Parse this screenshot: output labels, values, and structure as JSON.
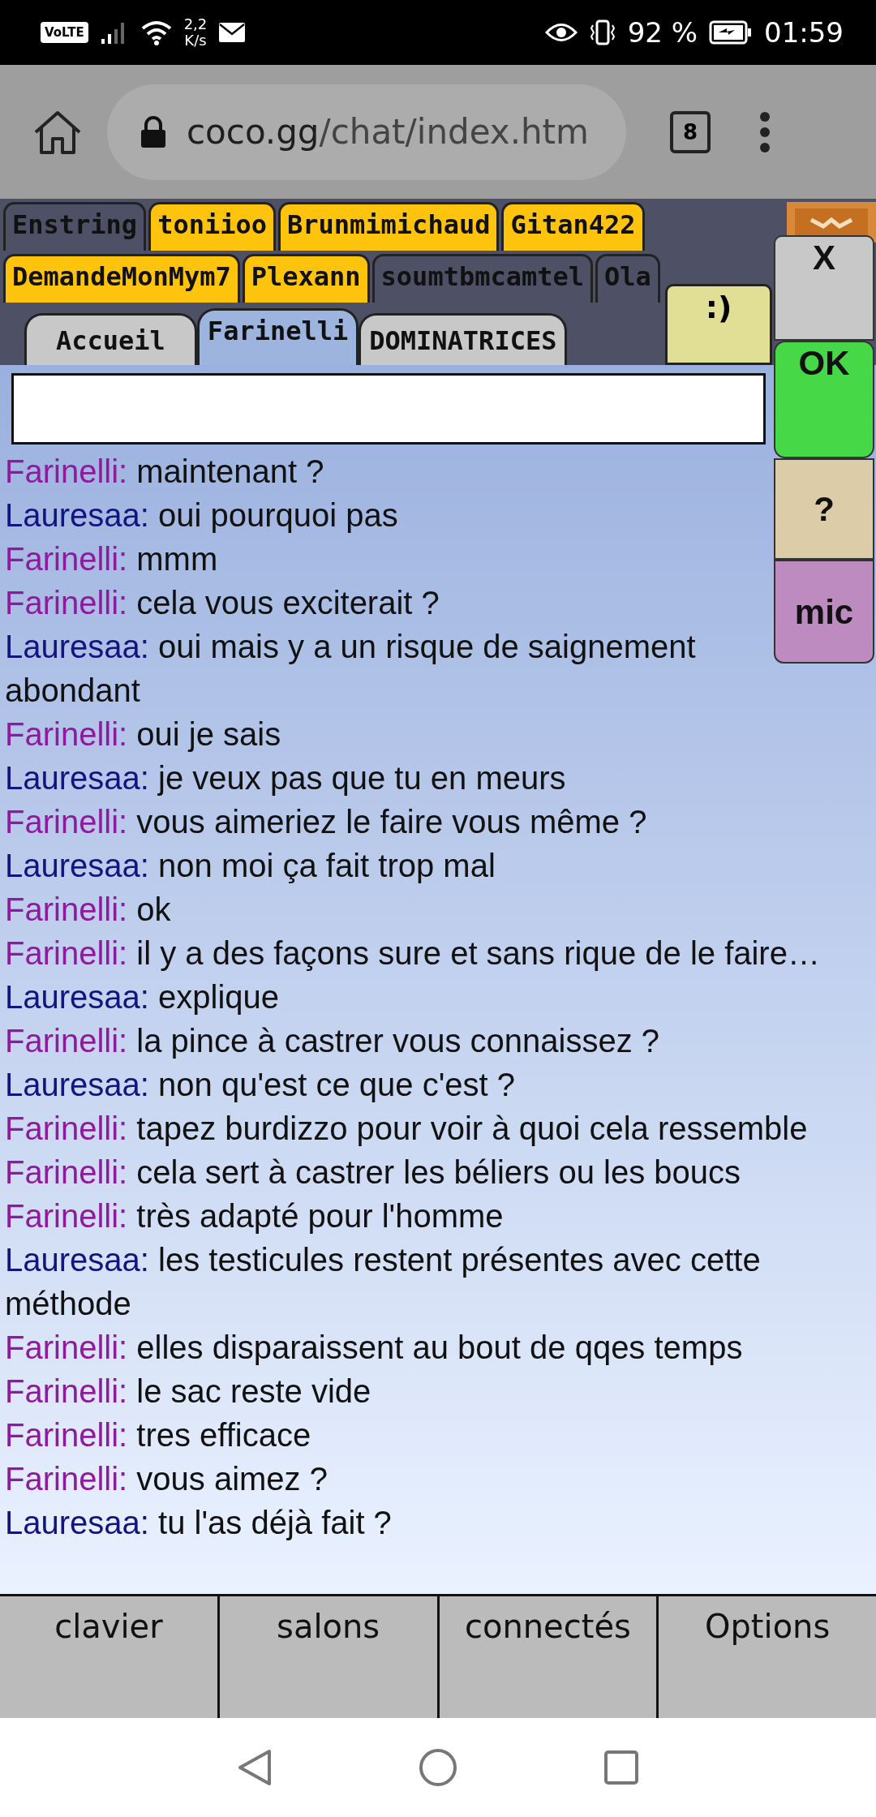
{
  "status_bar": {
    "network": "VoLTE",
    "speed_value": "2,2",
    "speed_unit": "K/s",
    "battery": "92 %",
    "time": "01:59"
  },
  "browser": {
    "url_domain": "coco.gg",
    "url_path": "/chat/index.htm",
    "tab_count": "8"
  },
  "user_tabs": [
    [
      {
        "label": "Enstring",
        "highlighted": false
      },
      {
        "label": "toniioo",
        "highlighted": true
      },
      {
        "label": "Brunmimichaud",
        "highlighted": true
      },
      {
        "label": "Gitan422",
        "highlighted": true
      }
    ],
    [
      {
        "label": "DemandeMonMym7",
        "highlighted": true
      },
      {
        "label": "Plexann",
        "highlighted": true
      },
      {
        "label": "soumtbmcamtel",
        "highlighted": false
      },
      {
        "label": "Ola",
        "highlighted": false
      }
    ]
  ],
  "room_tabs": [
    {
      "label": "Accueil",
      "selected": false
    },
    {
      "label": "Farinelli",
      "selected": true
    },
    {
      "label": "DOMINATRICES",
      "selected": false
    }
  ],
  "smiley_button": ":)",
  "side_buttons": [
    {
      "label": "X",
      "kind": "close"
    },
    {
      "label": "OK",
      "kind": "send"
    },
    {
      "label": "?",
      "kind": "help"
    },
    {
      "label": "mic",
      "kind": "mic"
    }
  ],
  "messages": [
    {
      "sender": "Farinelli:",
      "text": "maintenant ?",
      "color": "#8e1a9e"
    },
    {
      "sender": "Lauresaa:",
      "text": "oui pourquoi pas",
      "color": "#14147e"
    },
    {
      "sender": "Farinelli:",
      "text": "mmm",
      "color": "#8e1a9e"
    },
    {
      "sender": "Farinelli:",
      "text": "cela vous exciterait ?",
      "color": "#8e1a9e"
    },
    {
      "sender": "Lauresaa:",
      "text": "oui mais y a un risque de saignement abondant",
      "color": "#14147e"
    },
    {
      "sender": "Farinelli:",
      "text": "oui je sais",
      "color": "#8e1a9e"
    },
    {
      "sender": "Lauresaa:",
      "text": "je veux pas que tu en meurs",
      "color": "#14147e"
    },
    {
      "sender": "Farinelli:",
      "text": "vous aimeriez le faire vous même ?",
      "color": "#8e1a9e"
    },
    {
      "sender": "Lauresaa:",
      "text": "non moi ça fait trop mal",
      "color": "#14147e"
    },
    {
      "sender": "Farinelli:",
      "text": "ok",
      "color": "#8e1a9e"
    },
    {
      "sender": "Farinelli:",
      "text": "il y a des façons sure et sans rique de le faire…",
      "color": "#8e1a9e"
    },
    {
      "sender": "Lauresaa:",
      "text": "explique",
      "color": "#14147e"
    },
    {
      "sender": "Farinelli:",
      "text": "la pince à castrer vous connaissez ?",
      "color": "#8e1a9e"
    },
    {
      "sender": "Lauresaa:",
      "text": "non qu'est ce que c'est ?",
      "color": "#14147e"
    },
    {
      "sender": "Farinelli:",
      "text": "tapez burdizzo pour voir à quoi cela ressemble",
      "color": "#8e1a9e"
    },
    {
      "sender": "Farinelli:",
      "text": "cela sert à castrer les béliers ou les boucs",
      "color": "#8e1a9e"
    },
    {
      "sender": "Farinelli:",
      "text": "très adapté pour l'homme",
      "color": "#8e1a9e"
    },
    {
      "sender": "Lauresaa:",
      "text": "les testicules restent présentes avec cette méthode",
      "color": "#14147e"
    },
    {
      "sender": "Farinelli:",
      "text": "elles disparaissent au bout de qqes temps",
      "color": "#8e1a9e"
    },
    {
      "sender": "Farinelli:",
      "text": "le sac reste vide",
      "color": "#8e1a9e"
    },
    {
      "sender": "Farinelli:",
      "text": "tres efficace",
      "color": "#8e1a9e"
    },
    {
      "sender": "Farinelli:",
      "text": "vous aimez ?",
      "color": "#8e1a9e"
    },
    {
      "sender": "Lauresaa:",
      "text": "tu l'as déjà fait ?",
      "color": "#14147e"
    }
  ],
  "bottom_menu": [
    "clavier",
    "salons",
    "connectés",
    "Options"
  ]
}
